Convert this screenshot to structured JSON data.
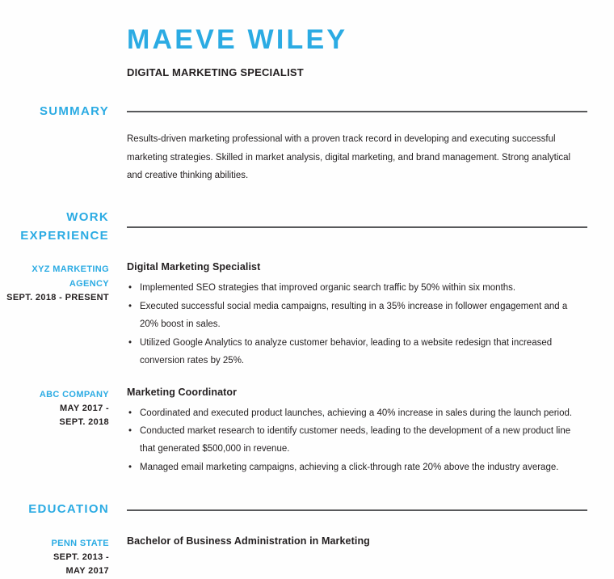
{
  "header": {
    "name": "MAEVE WILEY",
    "job_title": "DIGITAL MARKETING SPECIALIST"
  },
  "theme": {
    "accent_blue": "#2babe3",
    "text_dark": "#231f20",
    "rule_gray": "#58595b",
    "background": "#fefefe"
  },
  "sections": {
    "summary": {
      "heading": "SUMMARY",
      "body": "Results-driven marketing professional with a proven track record in developing and executing successful marketing strategies. Skilled in market analysis, digital marketing, and brand management. Strong analytical and creative thinking abilities."
    },
    "work_experience": {
      "heading_line1": "WORK",
      "heading_line2": "EXPERIENCE",
      "entries": [
        {
          "org_line1": "XYZ MARKETING",
          "org_line2": "AGENCY",
          "dates_line1": "SEPT. 2018 - PRESENT",
          "dates_line2": "",
          "title": "Digital Marketing Specialist",
          "bullets": [
            "Implemented SEO strategies that improved organic search traffic by 50% within six months.",
            "Executed successful social media campaigns, resulting in a 35% increase in follower engagement and a 20% boost in sales.",
            "Utilized Google Analytics to analyze customer behavior, leading to a website redesign that increased conversion rates by 25%."
          ]
        },
        {
          "org_line1": "ABC COMPANY",
          "org_line2": "",
          "dates_line1": "MAY 2017 -",
          "dates_line2": "SEPT. 2018",
          "title": "Marketing Coordinator",
          "bullets": [
            "Coordinated and executed product launches, achieving a 40% increase in sales during the launch period.",
            "Conducted market research to identify customer needs, leading to the development of a new product line that generated $500,000 in revenue.",
            "Managed email marketing campaigns, achieving a click-through rate 20% above the industry average."
          ]
        }
      ]
    },
    "education": {
      "heading": "EDUCATION",
      "entries": [
        {
          "org_line1": "PENN STATE",
          "dates_line1": "SEPT. 2013 -",
          "dates_line2": "MAY 2017",
          "title": "Bachelor of Business Administration in Marketing"
        }
      ]
    }
  }
}
